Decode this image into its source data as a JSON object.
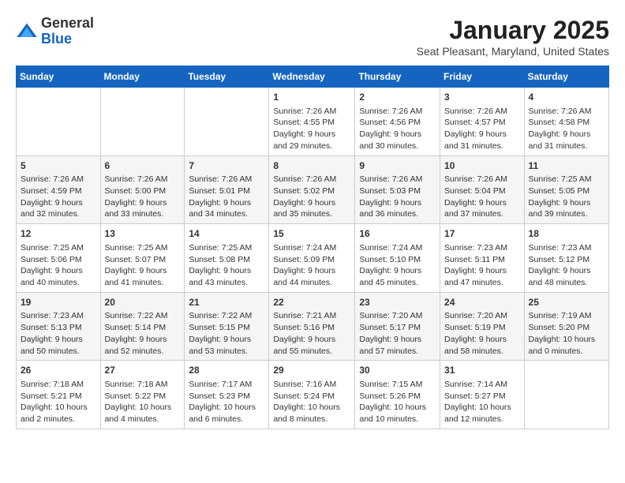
{
  "logo": {
    "general": "General",
    "blue": "Blue"
  },
  "header": {
    "month": "January 2025",
    "location": "Seat Pleasant, Maryland, United States"
  },
  "weekdays": [
    "Sunday",
    "Monday",
    "Tuesday",
    "Wednesday",
    "Thursday",
    "Friday",
    "Saturday"
  ],
  "weeks": [
    [
      {
        "day": "",
        "info": ""
      },
      {
        "day": "",
        "info": ""
      },
      {
        "day": "",
        "info": ""
      },
      {
        "day": "1",
        "info": "Sunrise: 7:26 AM\nSunset: 4:55 PM\nDaylight: 9 hours\nand 29 minutes."
      },
      {
        "day": "2",
        "info": "Sunrise: 7:26 AM\nSunset: 4:56 PM\nDaylight: 9 hours\nand 30 minutes."
      },
      {
        "day": "3",
        "info": "Sunrise: 7:26 AM\nSunset: 4:57 PM\nDaylight: 9 hours\nand 31 minutes."
      },
      {
        "day": "4",
        "info": "Sunrise: 7:26 AM\nSunset: 4:58 PM\nDaylight: 9 hours\nand 31 minutes."
      }
    ],
    [
      {
        "day": "5",
        "info": "Sunrise: 7:26 AM\nSunset: 4:59 PM\nDaylight: 9 hours\nand 32 minutes."
      },
      {
        "day": "6",
        "info": "Sunrise: 7:26 AM\nSunset: 5:00 PM\nDaylight: 9 hours\nand 33 minutes."
      },
      {
        "day": "7",
        "info": "Sunrise: 7:26 AM\nSunset: 5:01 PM\nDaylight: 9 hours\nand 34 minutes."
      },
      {
        "day": "8",
        "info": "Sunrise: 7:26 AM\nSunset: 5:02 PM\nDaylight: 9 hours\nand 35 minutes."
      },
      {
        "day": "9",
        "info": "Sunrise: 7:26 AM\nSunset: 5:03 PM\nDaylight: 9 hours\nand 36 minutes."
      },
      {
        "day": "10",
        "info": "Sunrise: 7:26 AM\nSunset: 5:04 PM\nDaylight: 9 hours\nand 37 minutes."
      },
      {
        "day": "11",
        "info": "Sunrise: 7:25 AM\nSunset: 5:05 PM\nDaylight: 9 hours\nand 39 minutes."
      }
    ],
    [
      {
        "day": "12",
        "info": "Sunrise: 7:25 AM\nSunset: 5:06 PM\nDaylight: 9 hours\nand 40 minutes."
      },
      {
        "day": "13",
        "info": "Sunrise: 7:25 AM\nSunset: 5:07 PM\nDaylight: 9 hours\nand 41 minutes."
      },
      {
        "day": "14",
        "info": "Sunrise: 7:25 AM\nSunset: 5:08 PM\nDaylight: 9 hours\nand 43 minutes."
      },
      {
        "day": "15",
        "info": "Sunrise: 7:24 AM\nSunset: 5:09 PM\nDaylight: 9 hours\nand 44 minutes."
      },
      {
        "day": "16",
        "info": "Sunrise: 7:24 AM\nSunset: 5:10 PM\nDaylight: 9 hours\nand 45 minutes."
      },
      {
        "day": "17",
        "info": "Sunrise: 7:23 AM\nSunset: 5:11 PM\nDaylight: 9 hours\nand 47 minutes."
      },
      {
        "day": "18",
        "info": "Sunrise: 7:23 AM\nSunset: 5:12 PM\nDaylight: 9 hours\nand 48 minutes."
      }
    ],
    [
      {
        "day": "19",
        "info": "Sunrise: 7:23 AM\nSunset: 5:13 PM\nDaylight: 9 hours\nand 50 minutes."
      },
      {
        "day": "20",
        "info": "Sunrise: 7:22 AM\nSunset: 5:14 PM\nDaylight: 9 hours\nand 52 minutes."
      },
      {
        "day": "21",
        "info": "Sunrise: 7:22 AM\nSunset: 5:15 PM\nDaylight: 9 hours\nand 53 minutes."
      },
      {
        "day": "22",
        "info": "Sunrise: 7:21 AM\nSunset: 5:16 PM\nDaylight: 9 hours\nand 55 minutes."
      },
      {
        "day": "23",
        "info": "Sunrise: 7:20 AM\nSunset: 5:17 PM\nDaylight: 9 hours\nand 57 minutes."
      },
      {
        "day": "24",
        "info": "Sunrise: 7:20 AM\nSunset: 5:19 PM\nDaylight: 9 hours\nand 58 minutes."
      },
      {
        "day": "25",
        "info": "Sunrise: 7:19 AM\nSunset: 5:20 PM\nDaylight: 10 hours\nand 0 minutes."
      }
    ],
    [
      {
        "day": "26",
        "info": "Sunrise: 7:18 AM\nSunset: 5:21 PM\nDaylight: 10 hours\nand 2 minutes."
      },
      {
        "day": "27",
        "info": "Sunrise: 7:18 AM\nSunset: 5:22 PM\nDaylight: 10 hours\nand 4 minutes."
      },
      {
        "day": "28",
        "info": "Sunrise: 7:17 AM\nSunset: 5:23 PM\nDaylight: 10 hours\nand 6 minutes."
      },
      {
        "day": "29",
        "info": "Sunrise: 7:16 AM\nSunset: 5:24 PM\nDaylight: 10 hours\nand 8 minutes."
      },
      {
        "day": "30",
        "info": "Sunrise: 7:15 AM\nSunset: 5:26 PM\nDaylight: 10 hours\nand 10 minutes."
      },
      {
        "day": "31",
        "info": "Sunrise: 7:14 AM\nSunset: 5:27 PM\nDaylight: 10 hours\nand 12 minutes."
      },
      {
        "day": "",
        "info": ""
      }
    ]
  ]
}
